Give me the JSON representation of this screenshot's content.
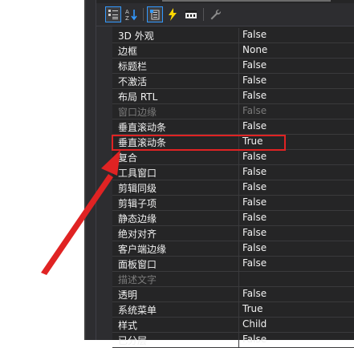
{
  "toolbar": {
    "buttons": [
      {
        "name": "categorized-button",
        "icon": "categorized-icon",
        "active": true
      },
      {
        "name": "alphabetical-button",
        "icon": "alphabetical-icon",
        "active": false
      },
      {
        "name": "properties-button",
        "icon": "properties-icon",
        "active": true
      },
      {
        "name": "events-button",
        "icon": "lightning-icon",
        "active": false
      },
      {
        "name": "messages-button",
        "icon": "messages-icon",
        "active": false
      },
      {
        "name": "overrides-button",
        "icon": "wrench-icon",
        "active": false
      }
    ]
  },
  "properties": [
    {
      "name": "3D 外观",
      "value": "False",
      "disabled": false
    },
    {
      "name": "边框",
      "value": "None",
      "disabled": false
    },
    {
      "name": "标题栏",
      "value": "False",
      "disabled": false
    },
    {
      "name": "不激活",
      "value": "False",
      "disabled": false
    },
    {
      "name": "布局 RTL",
      "value": "False",
      "disabled": false
    },
    {
      "name": "窗口边缘",
      "value": "False",
      "disabled": true
    },
    {
      "name": "垂直滚动条",
      "value": "False",
      "disabled": false
    },
    {
      "name": "垂直滚动条",
      "value": "True",
      "disabled": false
    },
    {
      "name": "复合",
      "value": "False",
      "disabled": false
    },
    {
      "name": "工具窗口",
      "value": "False",
      "disabled": false
    },
    {
      "name": "剪辑同级",
      "value": "False",
      "disabled": false
    },
    {
      "name": "剪辑子项",
      "value": "False",
      "disabled": false
    },
    {
      "name": "静态边缘",
      "value": "False",
      "disabled": false
    },
    {
      "name": "绝对对齐",
      "value": "False",
      "disabled": false
    },
    {
      "name": "客户端边缘",
      "value": "False",
      "disabled": false
    },
    {
      "name": "面板窗口",
      "value": "False",
      "disabled": false
    },
    {
      "name": "描述文字",
      "value": "",
      "disabled": true
    },
    {
      "name": "透明",
      "value": "False",
      "disabled": false
    },
    {
      "name": "系统菜单",
      "value": "True",
      "disabled": false
    },
    {
      "name": "样式",
      "value": "Child",
      "disabled": false
    },
    {
      "name": "已分层",
      "value": "False",
      "disabled": false
    }
  ],
  "colors": {
    "highlight": "#e02323",
    "arrow": "#e02323",
    "toolbar_active_border": "#3399ff",
    "lightning": "#ffd700"
  }
}
